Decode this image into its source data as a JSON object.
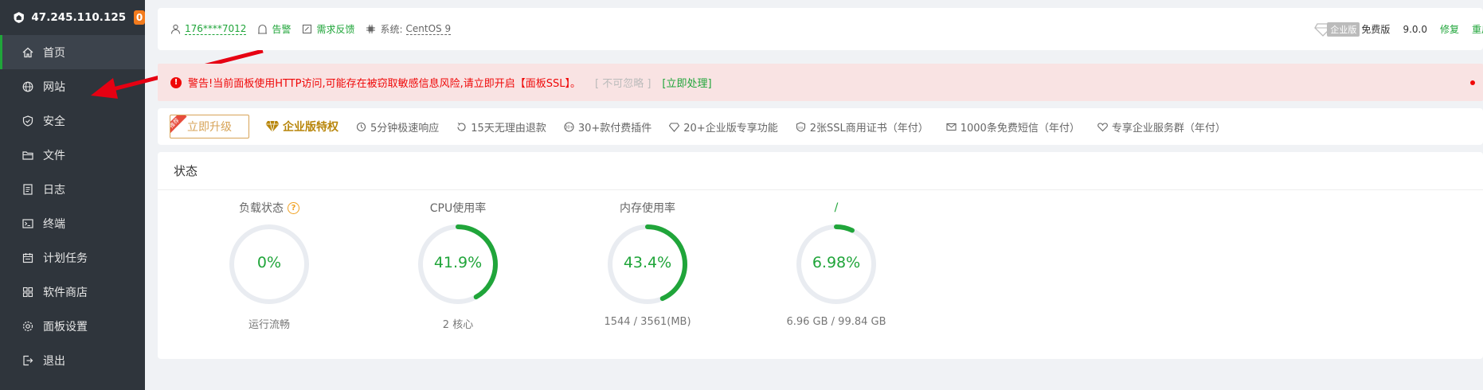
{
  "sidebar": {
    "server_ip": "47.245.110.125",
    "badge_count": "0",
    "items": [
      {
        "label": "首页",
        "icon": "home-icon",
        "active": true
      },
      {
        "label": "网站",
        "icon": "globe-icon"
      },
      {
        "label": "安全",
        "icon": "shield-icon"
      },
      {
        "label": "文件",
        "icon": "folder-icon"
      },
      {
        "label": "日志",
        "icon": "log-icon"
      },
      {
        "label": "终端",
        "icon": "terminal-icon"
      },
      {
        "label": "计划任务",
        "icon": "calendar-icon"
      },
      {
        "label": "软件商店",
        "icon": "apps-icon"
      },
      {
        "label": "面板设置",
        "icon": "settings-icon"
      },
      {
        "label": "退出",
        "icon": "logout-icon"
      }
    ]
  },
  "topbar": {
    "user": "176****7012",
    "alarm": "告警",
    "feedback": "需求反馈",
    "system_label": "系统:",
    "system_value": "CentOS 9",
    "enterprise_tag": "企业版",
    "edition": "免费版",
    "version": "9.0.0",
    "repair": "修复",
    "restart": "重启"
  },
  "alert": {
    "message": "警告!当前面板使用HTTP访问,可能存在被窃取敏感信息风险,请立即开启【面板SSL】。",
    "ignore": "[ 不可忽略 ]",
    "action": "[立即处理]"
  },
  "promo": {
    "upgrade_button": "立即升级",
    "ribbon": "推荐",
    "title": "企业版特权",
    "features": [
      "5分钟极速响应",
      "15天无理由退款",
      "30+款付费插件",
      "20+企业版专享功能",
      "2张SSL商用证书（年付）",
      "1000条免费短信（年付）",
      "专享企业服务群（年付）"
    ]
  },
  "status": {
    "title": "状态",
    "help_mark": "?",
    "gauges": [
      {
        "label": "负载状态",
        "value": "0%",
        "percent": 0,
        "sub": "运行流畅"
      },
      {
        "label": "CPU使用率",
        "value": "41.9%",
        "percent": 41.9,
        "sub": "2 核心"
      },
      {
        "label": "内存使用率",
        "value": "43.4%",
        "percent": 43.4,
        "sub": "1544 / 3561(MB)"
      },
      {
        "label": "/",
        "value": "6.98%",
        "percent": 6.98,
        "sub": "6.96 GB / 99.84 GB"
      }
    ]
  },
  "colors": {
    "accent": "#20a53a",
    "sidebar_bg": "#2f353c",
    "alert_text": "#ef0808",
    "alert_bg": "#f9e3e3",
    "gold": "#d7a357",
    "annotation_arrow": "#e60012"
  }
}
